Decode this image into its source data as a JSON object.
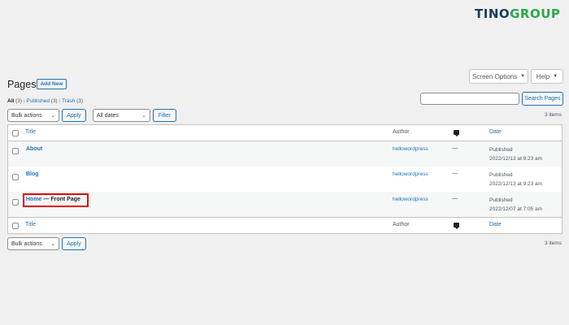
{
  "brand": {
    "part1": "TINO",
    "part2": "GROUP"
  },
  "screen_options": {
    "label": "Screen Options",
    "arrow": "▼"
  },
  "help": {
    "label": "Help",
    "arrow": "▼"
  },
  "page_title": "Pages",
  "add_new": "Add New",
  "filters": [
    {
      "label": "All",
      "count": "(3)",
      "current": true
    },
    {
      "label": "Published",
      "count": "(3)",
      "current": false
    },
    {
      "label": "Trash",
      "count": "(3)",
      "current": false
    }
  ],
  "filter_sep": "|",
  "search": {
    "value": "",
    "button": "Search Pages"
  },
  "bulk_actions": {
    "selected": "Bulk actions",
    "apply": "Apply"
  },
  "date_filter": {
    "selected": "All dates",
    "button": "Filter"
  },
  "items_count": "3 items",
  "columns": {
    "title": "Title",
    "author": "Author",
    "comments_icon": "comment-bubble-icon",
    "date": "Date"
  },
  "rows": [
    {
      "title": "About",
      "author": "hellowordpress",
      "comments": "—",
      "status": "Published",
      "date": "2022/12/13 at 9:23 am"
    },
    {
      "title": "Blog",
      "author": "hellowordpress",
      "comments": "—",
      "status": "Published",
      "date": "2022/12/13 at 9:23 am"
    },
    {
      "title": "Home",
      "title_suffix": "— Front Page",
      "author": "hellowordpress",
      "comments": "—",
      "status": "Published",
      "date": "2022/12/07 at 7:05 am"
    }
  ],
  "colors": {
    "link": "#2271b1",
    "highlight": "#e00000",
    "background": "#f0f0f1"
  }
}
